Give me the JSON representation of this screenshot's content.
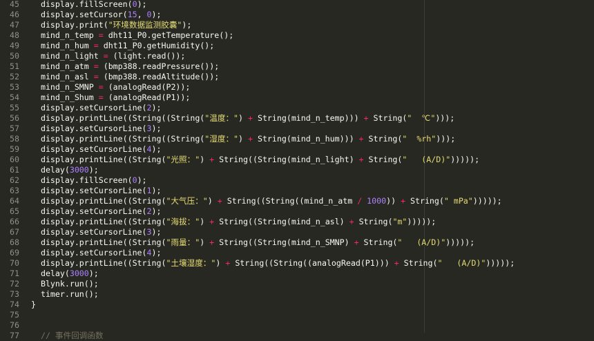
{
  "editor": {
    "colors": {
      "background": "#272822",
      "plain": "#f8f8f2",
      "operator": "#f92672",
      "number": "#ae81ff",
      "string": "#e6db74",
      "comment": "#75715e",
      "line_number": "#8f908a"
    },
    "lines": [
      {
        "n": "45",
        "tokens": [
          {
            "t": "  display.fillScreen(",
            "c": "plain"
          },
          {
            "t": "0",
            "c": "num"
          },
          {
            "t": ");",
            "c": "plain"
          }
        ]
      },
      {
        "n": "46",
        "tokens": [
          {
            "t": "  display.setCursor(",
            "c": "plain"
          },
          {
            "t": "15",
            "c": "num"
          },
          {
            "t": ", ",
            "c": "plain"
          },
          {
            "t": "0",
            "c": "num"
          },
          {
            "t": ");",
            "c": "plain"
          }
        ]
      },
      {
        "n": "47",
        "tokens": [
          {
            "t": "  display.print(",
            "c": "plain"
          },
          {
            "t": "\"环境数据监测胶囊\"",
            "c": "str"
          },
          {
            "t": ");",
            "c": "plain"
          }
        ]
      },
      {
        "n": "48",
        "tokens": [
          {
            "t": "  mind_n_temp ",
            "c": "plain"
          },
          {
            "t": "=",
            "c": "op"
          },
          {
            "t": " dht11_P0.getTemperature();",
            "c": "plain"
          }
        ]
      },
      {
        "n": "49",
        "tokens": [
          {
            "t": "  mind_n_hum ",
            "c": "plain"
          },
          {
            "t": "=",
            "c": "op"
          },
          {
            "t": " dht11_P0.getHumidity();",
            "c": "plain"
          }
        ]
      },
      {
        "n": "50",
        "tokens": [
          {
            "t": "  mind_n_light ",
            "c": "plain"
          },
          {
            "t": "=",
            "c": "op"
          },
          {
            "t": " (light.read());",
            "c": "plain"
          }
        ]
      },
      {
        "n": "51",
        "tokens": [
          {
            "t": "  mind_n_atm ",
            "c": "plain"
          },
          {
            "t": "=",
            "c": "op"
          },
          {
            "t": " (bmp388.readPressure());",
            "c": "plain"
          }
        ]
      },
      {
        "n": "52",
        "tokens": [
          {
            "t": "  mind_n_asl ",
            "c": "plain"
          },
          {
            "t": "=",
            "c": "op"
          },
          {
            "t": " (bmp388.readAltitude());",
            "c": "plain"
          }
        ]
      },
      {
        "n": "53",
        "tokens": [
          {
            "t": "  mind_n_SMNP ",
            "c": "plain"
          },
          {
            "t": "=",
            "c": "op"
          },
          {
            "t": " (analogRead(P2));",
            "c": "plain"
          }
        ]
      },
      {
        "n": "54",
        "tokens": [
          {
            "t": "  mind_n_Shum ",
            "c": "plain"
          },
          {
            "t": "=",
            "c": "op"
          },
          {
            "t": " (analogRead(P1));",
            "c": "plain"
          }
        ]
      },
      {
        "n": "55",
        "tokens": [
          {
            "t": "  display.setCursorLine(",
            "c": "plain"
          },
          {
            "t": "2",
            "c": "num"
          },
          {
            "t": ");",
            "c": "plain"
          }
        ]
      },
      {
        "n": "56",
        "tokens": [
          {
            "t": "  display.printLine((String((String(",
            "c": "plain"
          },
          {
            "t": "\"温度：\"",
            "c": "str"
          },
          {
            "t": ") ",
            "c": "plain"
          },
          {
            "t": "+",
            "c": "op"
          },
          {
            "t": " String(mind_n_temp))) ",
            "c": "plain"
          },
          {
            "t": "+",
            "c": "op"
          },
          {
            "t": " String(",
            "c": "plain"
          },
          {
            "t": "\"  ℃\"",
            "c": "str"
          },
          {
            "t": ")));",
            "c": "plain"
          }
        ]
      },
      {
        "n": "57",
        "tokens": [
          {
            "t": "  display.setCursorLine(",
            "c": "plain"
          },
          {
            "t": "3",
            "c": "num"
          },
          {
            "t": ");",
            "c": "plain"
          }
        ]
      },
      {
        "n": "58",
        "tokens": [
          {
            "t": "  display.printLine((String((String(",
            "c": "plain"
          },
          {
            "t": "\"湿度：\"",
            "c": "str"
          },
          {
            "t": ") ",
            "c": "plain"
          },
          {
            "t": "+",
            "c": "op"
          },
          {
            "t": " String(mind_n_hum))) ",
            "c": "plain"
          },
          {
            "t": "+",
            "c": "op"
          },
          {
            "t": " String(",
            "c": "plain"
          },
          {
            "t": "\"  %rh\"",
            "c": "str"
          },
          {
            "t": ")));",
            "c": "plain"
          }
        ]
      },
      {
        "n": "59",
        "tokens": [
          {
            "t": "  display.setCursorLine(",
            "c": "plain"
          },
          {
            "t": "4",
            "c": "num"
          },
          {
            "t": ");",
            "c": "plain"
          }
        ]
      },
      {
        "n": "60",
        "tokens": [
          {
            "t": "  display.printLine((String(",
            "c": "plain"
          },
          {
            "t": "\"光照：\"",
            "c": "str"
          },
          {
            "t": ") ",
            "c": "plain"
          },
          {
            "t": "+",
            "c": "op"
          },
          {
            "t": " String((String(mind_n_light) ",
            "c": "plain"
          },
          {
            "t": "+",
            "c": "op"
          },
          {
            "t": " String(",
            "c": "plain"
          },
          {
            "t": "\"   (A/D)\"",
            "c": "str"
          },
          {
            "t": ")))));",
            "c": "plain"
          }
        ]
      },
      {
        "n": "61",
        "tokens": [
          {
            "t": "  delay(",
            "c": "plain"
          },
          {
            "t": "3000",
            "c": "num"
          },
          {
            "t": ");",
            "c": "plain"
          }
        ]
      },
      {
        "n": "62",
        "tokens": [
          {
            "t": "  display.fillScreen(",
            "c": "plain"
          },
          {
            "t": "0",
            "c": "num"
          },
          {
            "t": ");",
            "c": "plain"
          }
        ]
      },
      {
        "n": "63",
        "tokens": [
          {
            "t": "  display.setCursorLine(",
            "c": "plain"
          },
          {
            "t": "1",
            "c": "num"
          },
          {
            "t": ");",
            "c": "plain"
          }
        ]
      },
      {
        "n": "64",
        "tokens": [
          {
            "t": "  display.printLine((String(",
            "c": "plain"
          },
          {
            "t": "\"大气压：\"",
            "c": "str"
          },
          {
            "t": ") ",
            "c": "plain"
          },
          {
            "t": "+",
            "c": "op"
          },
          {
            "t": " String((String((mind_n_atm ",
            "c": "plain"
          },
          {
            "t": "/",
            "c": "op"
          },
          {
            "t": " ",
            "c": "plain"
          },
          {
            "t": "1000",
            "c": "num"
          },
          {
            "t": ")) ",
            "c": "plain"
          },
          {
            "t": "+",
            "c": "op"
          },
          {
            "t": " String(",
            "c": "plain"
          },
          {
            "t": "\" mPa\"",
            "c": "str"
          },
          {
            "t": ")))));",
            "c": "plain"
          }
        ]
      },
      {
        "n": "65",
        "tokens": [
          {
            "t": "  display.setCursorLine(",
            "c": "plain"
          },
          {
            "t": "2",
            "c": "num"
          },
          {
            "t": ");",
            "c": "plain"
          }
        ]
      },
      {
        "n": "66",
        "tokens": [
          {
            "t": "  display.printLine((String(",
            "c": "plain"
          },
          {
            "t": "\"海拔：\"",
            "c": "str"
          },
          {
            "t": ") ",
            "c": "plain"
          },
          {
            "t": "+",
            "c": "op"
          },
          {
            "t": " String((String(mind_n_asl) ",
            "c": "plain"
          },
          {
            "t": "+",
            "c": "op"
          },
          {
            "t": " String(",
            "c": "plain"
          },
          {
            "t": "\"m\"",
            "c": "str"
          },
          {
            "t": ")))));",
            "c": "plain"
          }
        ]
      },
      {
        "n": "67",
        "tokens": [
          {
            "t": "  display.setCursorLine(",
            "c": "plain"
          },
          {
            "t": "3",
            "c": "num"
          },
          {
            "t": ");",
            "c": "plain"
          }
        ]
      },
      {
        "n": "68",
        "tokens": [
          {
            "t": "  display.printLine((String(",
            "c": "plain"
          },
          {
            "t": "\"雨量：\"",
            "c": "str"
          },
          {
            "t": ") ",
            "c": "plain"
          },
          {
            "t": "+",
            "c": "op"
          },
          {
            "t": " String((String(mind_n_SMNP) ",
            "c": "plain"
          },
          {
            "t": "+",
            "c": "op"
          },
          {
            "t": " String(",
            "c": "plain"
          },
          {
            "t": "\"   (A/D)\"",
            "c": "str"
          },
          {
            "t": ")))));",
            "c": "plain"
          }
        ]
      },
      {
        "n": "69",
        "tokens": [
          {
            "t": "  display.setCursorLine(",
            "c": "plain"
          },
          {
            "t": "4",
            "c": "num"
          },
          {
            "t": ");",
            "c": "plain"
          }
        ]
      },
      {
        "n": "70",
        "tokens": [
          {
            "t": "  display.printLine((String(",
            "c": "plain"
          },
          {
            "t": "\"土壤湿度：\"",
            "c": "str"
          },
          {
            "t": ") ",
            "c": "plain"
          },
          {
            "t": "+",
            "c": "op"
          },
          {
            "t": " String((String((analogRead(P1))) ",
            "c": "plain"
          },
          {
            "t": "+",
            "c": "op"
          },
          {
            "t": " String(",
            "c": "plain"
          },
          {
            "t": "\"   (A/D)\"",
            "c": "str"
          },
          {
            "t": ")))));",
            "c": "plain"
          }
        ]
      },
      {
        "n": "71",
        "tokens": [
          {
            "t": "  delay(",
            "c": "plain"
          },
          {
            "t": "3000",
            "c": "num"
          },
          {
            "t": ");",
            "c": "plain"
          }
        ]
      },
      {
        "n": "72",
        "tokens": [
          {
            "t": "  Blynk.run();",
            "c": "plain"
          }
        ]
      },
      {
        "n": "73",
        "tokens": [
          {
            "t": "  timer.run();",
            "c": "plain"
          }
        ]
      },
      {
        "n": "74",
        "tokens": [
          {
            "t": "}",
            "c": "plain"
          }
        ]
      },
      {
        "n": "75",
        "tokens": []
      },
      {
        "n": "76",
        "tokens": []
      },
      {
        "n": "77",
        "tokens": [
          {
            "t": "  // 事件回调函数",
            "c": "comment"
          }
        ]
      }
    ]
  }
}
